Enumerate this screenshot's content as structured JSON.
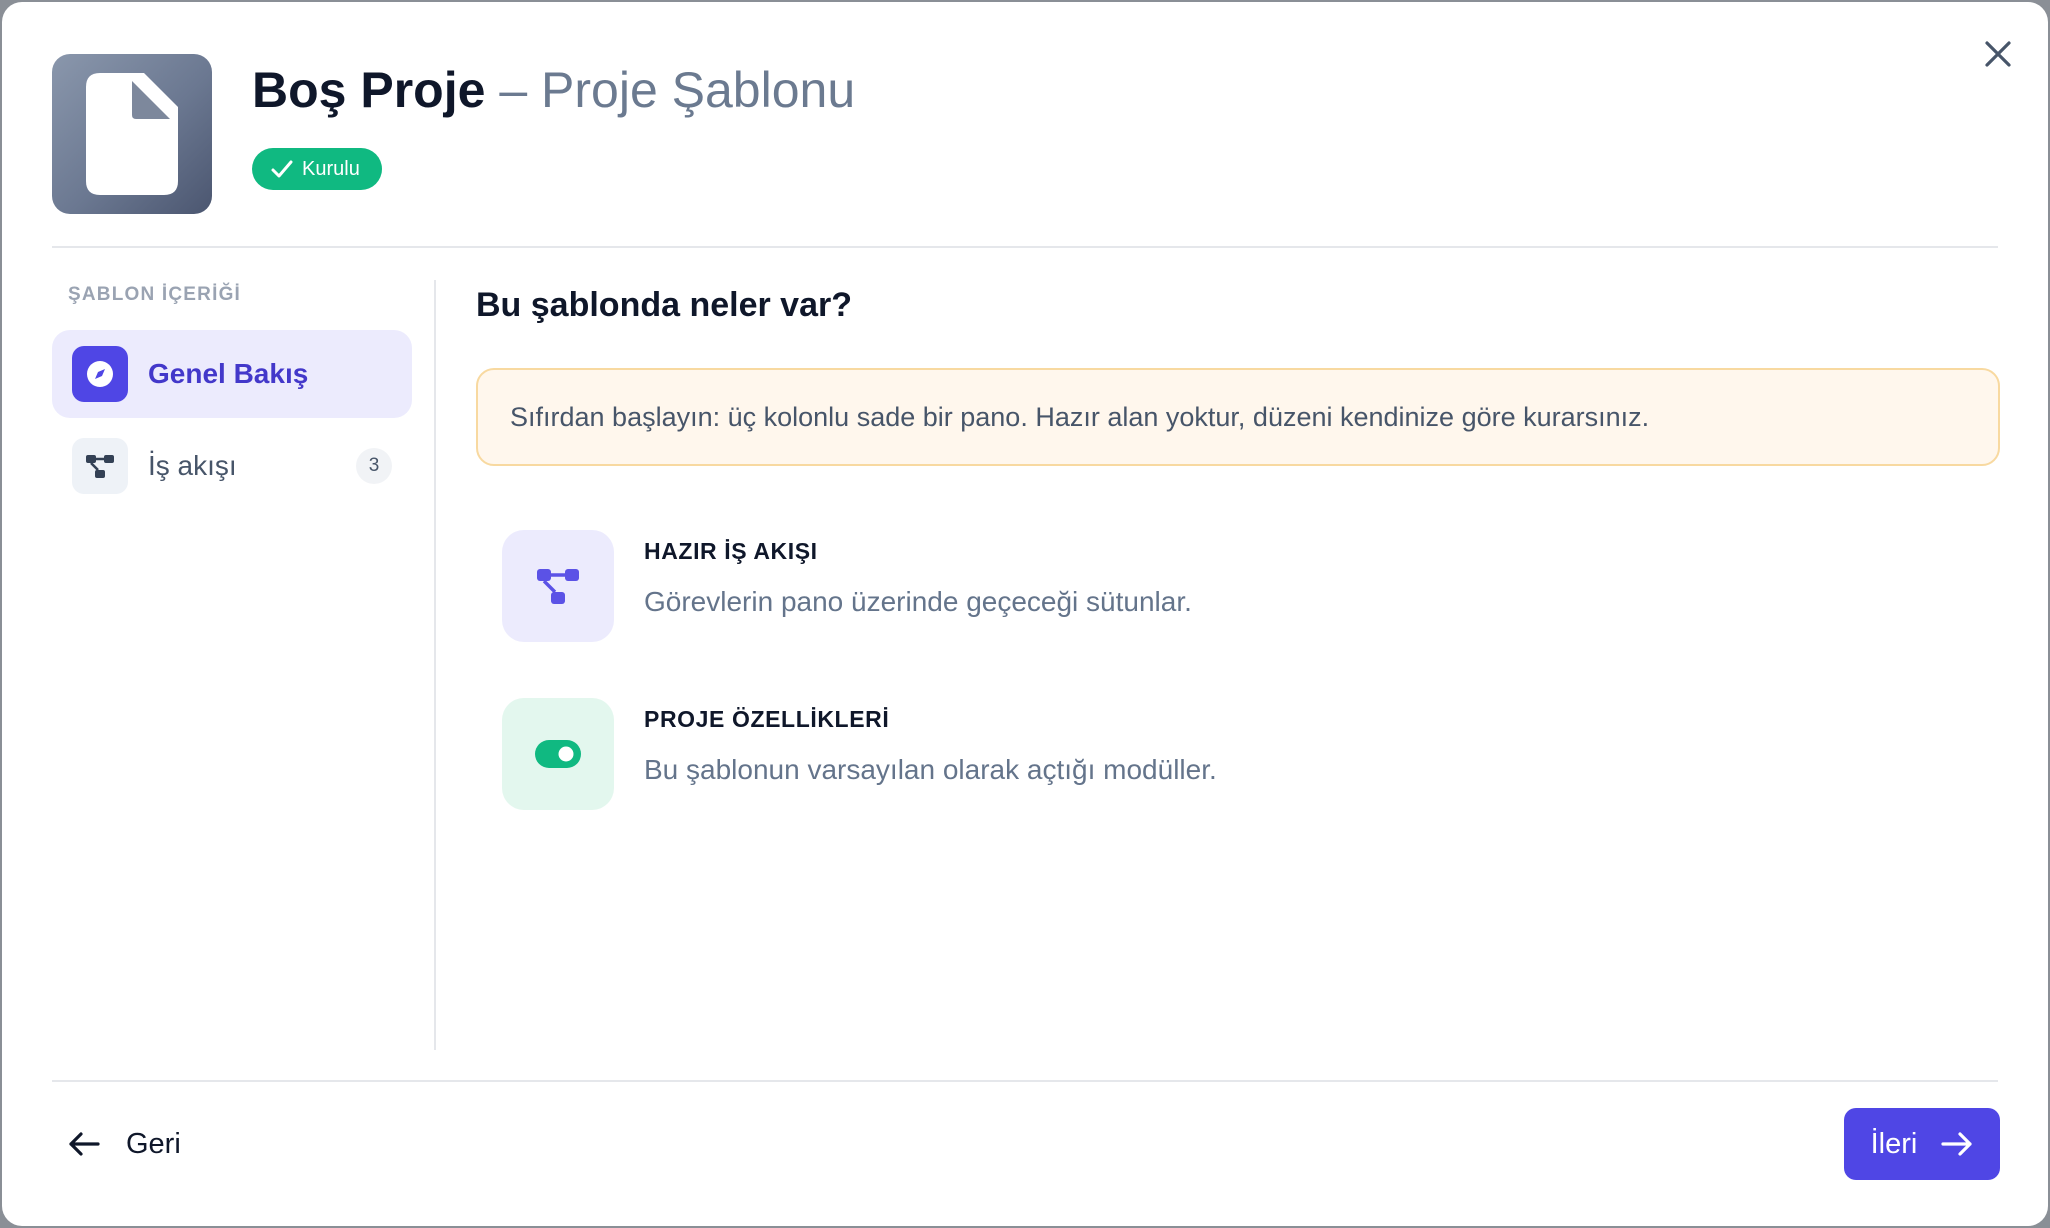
{
  "header": {
    "title": "Boş Proje",
    "separator": "–",
    "subtitle": "Proje Şablonu",
    "badge": "Kurulu",
    "icon": "file-icon"
  },
  "sidebar": {
    "heading": "ŞABLON İÇERİĞİ",
    "items": [
      {
        "label": "Genel Bakış",
        "icon": "compass-icon",
        "active": true,
        "count": ""
      },
      {
        "label": "İş akışı",
        "icon": "workflow-icon",
        "active": false,
        "count": "3"
      }
    ]
  },
  "main": {
    "title": "Bu şablonda neler var?",
    "notice": "Sıfırdan başlayın: üç kolonlu sade bir pano. Hazır alan yoktur, düzeni kendinize göre kurarsınız.",
    "features": [
      {
        "title": "HAZIR İŞ AKIŞI",
        "description": "Görevlerin pano üzerinde geçeceği sütunlar.",
        "icon": "workflow-icon"
      },
      {
        "title": "PROJE ÖZELLİKLERİ",
        "description": "Bu şablonun varsayılan olarak açtığı modüller.",
        "icon": "toggle-icon"
      }
    ]
  },
  "footer": {
    "back_label": "Geri",
    "next_label": "İleri"
  },
  "colors": {
    "accent": "#4f46e5",
    "success": "#10b981",
    "notice_bg": "#fff7ed",
    "notice_border": "#f8d9a0"
  }
}
